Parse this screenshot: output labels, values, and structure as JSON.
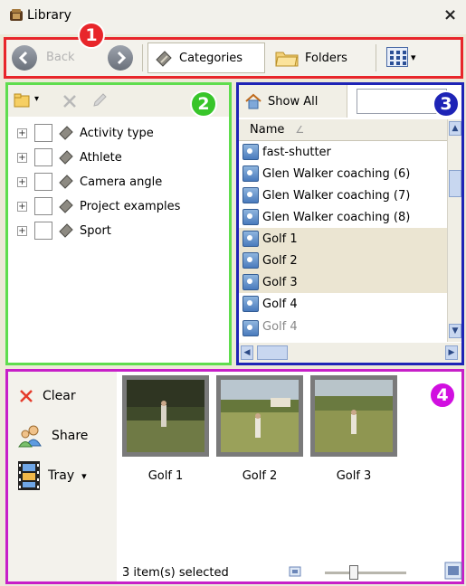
{
  "window": {
    "title": "Library",
    "close_glyph": "×"
  },
  "toolbar": {
    "back_label": "Back",
    "categories_label": "Categories",
    "folders_label": "Folders",
    "view_dropdown_glyph": "▾"
  },
  "badges": [
    "1",
    "2",
    "3",
    "4"
  ],
  "categories_tree": {
    "items": [
      {
        "label": "Activity type"
      },
      {
        "label": "Athlete"
      },
      {
        "label": "Camera angle"
      },
      {
        "label": "Project examples"
      },
      {
        "label": "Sport"
      }
    ]
  },
  "file_list": {
    "show_all_label": "Show All",
    "search_value": "",
    "column_header": "Name",
    "sort_glyph": "∠",
    "rows": [
      {
        "name": "fast-shutter",
        "selected": false
      },
      {
        "name": "Glen Walker coaching (6)",
        "selected": false
      },
      {
        "name": "Glen Walker coaching (7)",
        "selected": false
      },
      {
        "name": "Glen Walker coaching (8)",
        "selected": false
      },
      {
        "name": "Golf 1",
        "selected": true
      },
      {
        "name": "Golf 2",
        "selected": true
      },
      {
        "name": "Golf 3",
        "selected": true
      },
      {
        "name": "Golf 4",
        "selected": false
      },
      {
        "name": "Golf 4",
        "selected": false
      }
    ]
  },
  "tray": {
    "clear_label": "Clear",
    "share_label": "Share",
    "tray_label": "Tray",
    "tray_dropdown_glyph": "▾",
    "thumbnails": [
      {
        "label": "Golf 1"
      },
      {
        "label": "Golf 2"
      },
      {
        "label": "Golf 3"
      }
    ],
    "status_text": "3 item(s) selected",
    "zoom_fraction": 0.35
  },
  "colors": {
    "region1": "#e8262b",
    "region2": "#5fdd4e",
    "region3": "#1e24b6",
    "region4": "#c71fc8",
    "selection": "#ebe5d2"
  }
}
